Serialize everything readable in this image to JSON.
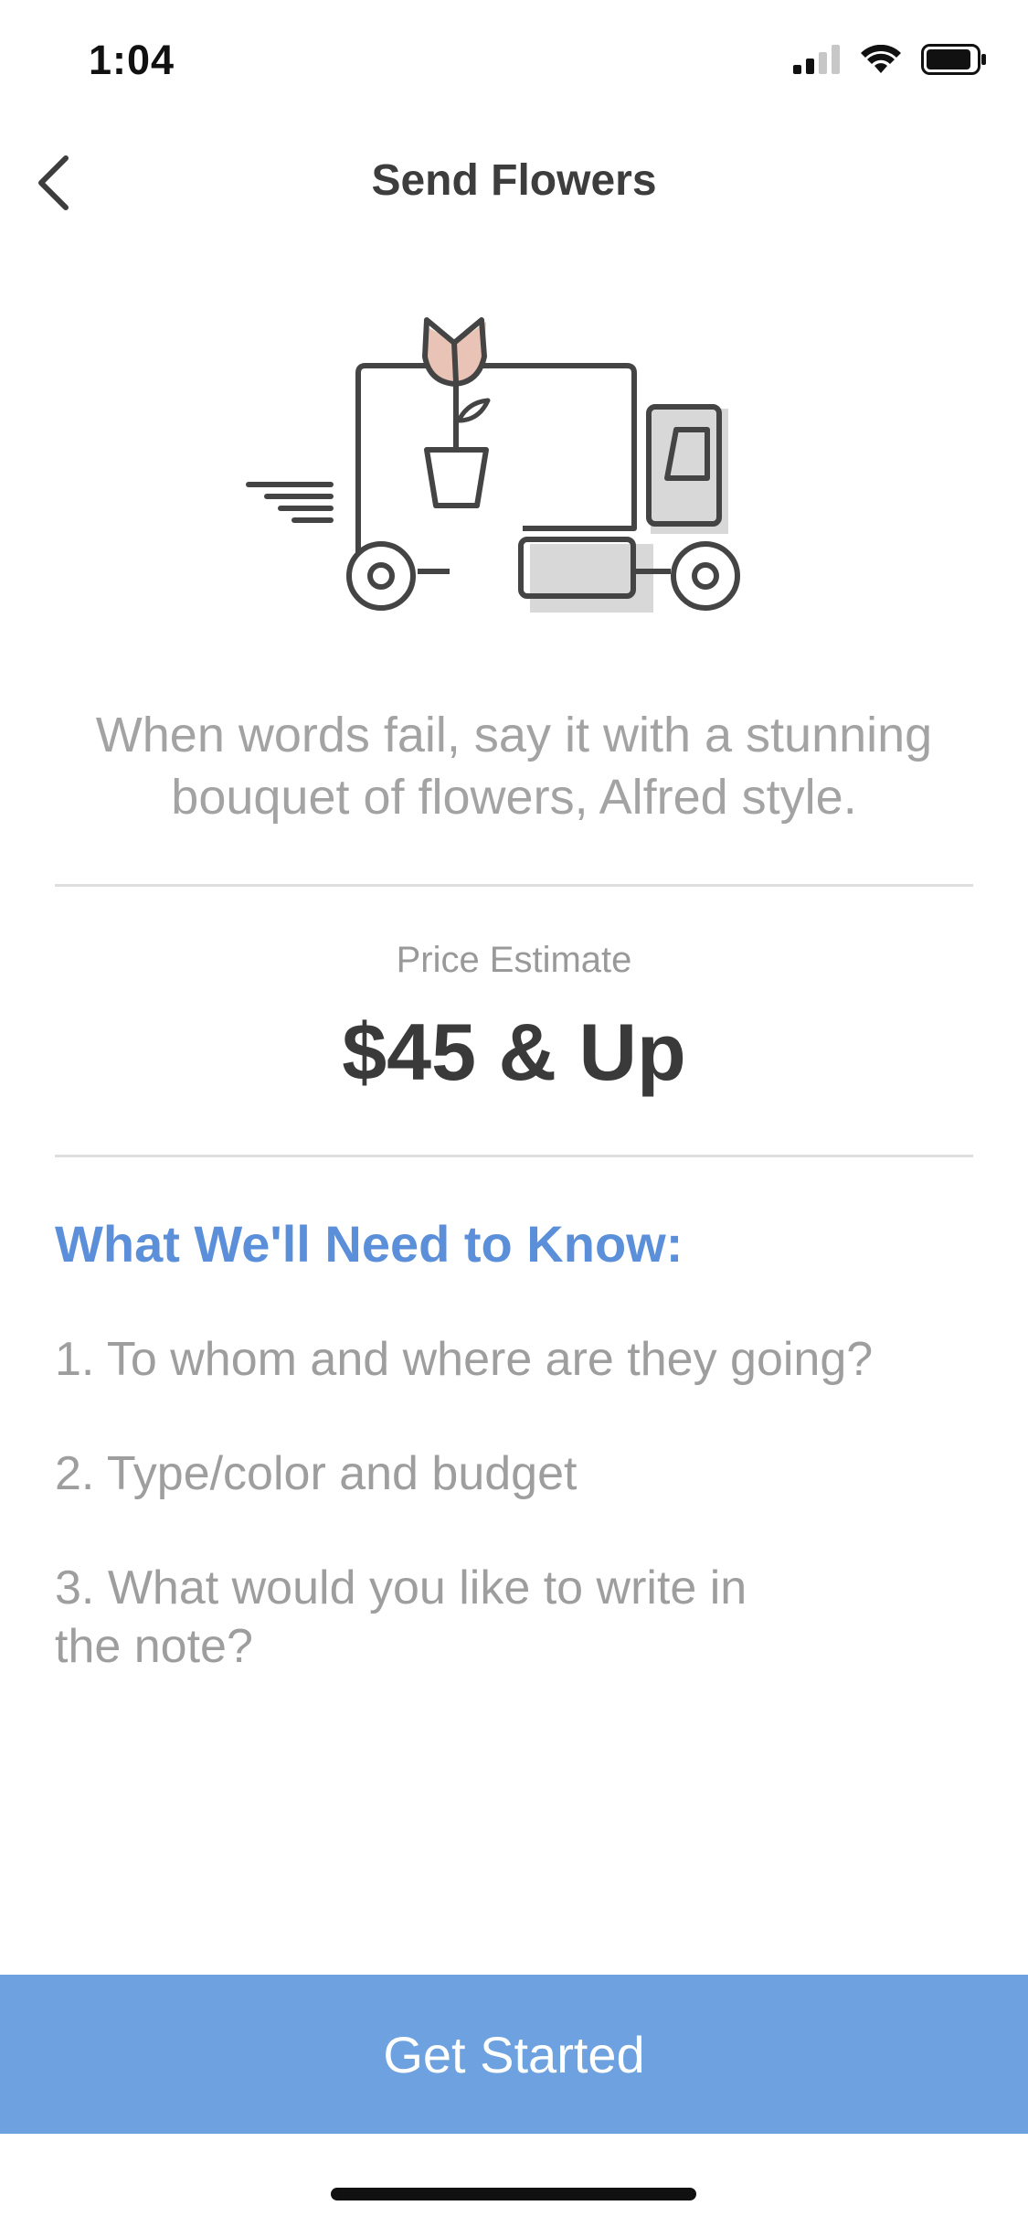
{
  "status_bar": {
    "time": "1:04",
    "icons": [
      "cellular-signal-icon",
      "wifi-icon",
      "battery-icon"
    ]
  },
  "nav": {
    "title": "Send Flowers",
    "back_icon": "chevron-left-icon"
  },
  "illustration": {
    "icon": "flower-delivery-truck-icon",
    "colors": {
      "line": "#444444",
      "petal": "#e8c3b6",
      "shadow": "#d8d8d8"
    }
  },
  "tagline": "When words fail, say it with a stunning bouquet of flowers, Alfred style.",
  "price": {
    "label": "Price Estimate",
    "value": "$45 & Up"
  },
  "needs": {
    "heading": "What We'll Need to Know:",
    "items": [
      "1. To whom and where are they going?",
      "2. Type/color and budget",
      "3. What would you like to write in the note?"
    ]
  },
  "cta": {
    "label": "Get Started"
  },
  "colors": {
    "accent": "#5b8fd9",
    "button": "#6ea1e0"
  }
}
